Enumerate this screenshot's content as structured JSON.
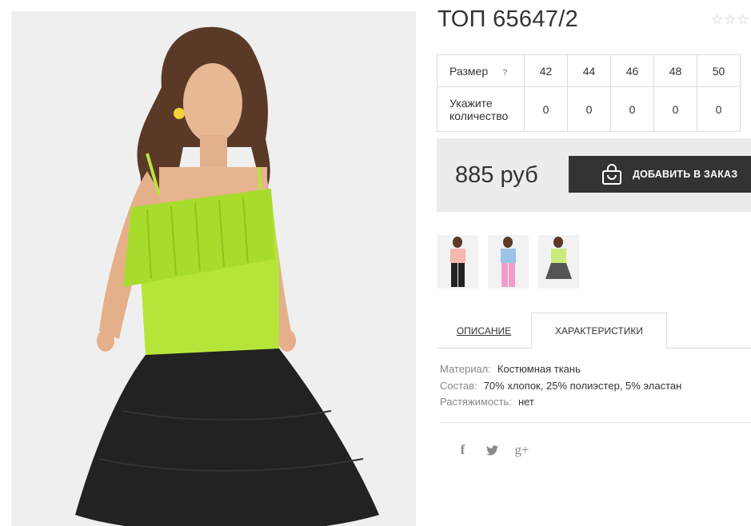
{
  "product": {
    "title": "ТОП 65647/2",
    "rating_stars": [
      "☆",
      "☆",
      "☆"
    ]
  },
  "size_table": {
    "size_label": "Размер",
    "help": "?",
    "sizes": [
      "42",
      "44",
      "46",
      "48",
      "50"
    ],
    "qty_label_line1": "Укажите",
    "qty_label_line2": "количество",
    "quantities": [
      "0",
      "0",
      "0",
      "0",
      "0"
    ]
  },
  "order": {
    "price": "885 руб",
    "add_button_label": "ДОБАВИТЬ В ЗАКАЗ"
  },
  "tabs": {
    "description": "ОПИСАНИЕ",
    "characteristics": "ХАРАКТЕРИСТИКИ"
  },
  "characteristics": [
    {
      "key": "Материал:",
      "value": "Костюмная ткань"
    },
    {
      "key": "Состав:",
      "value": "70% хлопок, 25% полиэстер, 5% эластан"
    },
    {
      "key": "Растяжимость:",
      "value": "нет"
    }
  ],
  "social": {
    "facebook": "f",
    "twitter": "t",
    "gplus": "g+"
  },
  "colors": {
    "top_lime": "#b6e53a",
    "skirt_black": "#222222",
    "button_dark": "#333333",
    "panel_grey": "#ececec"
  },
  "icons": [
    "shopping-bag-icon",
    "facebook-icon",
    "twitter-icon",
    "google-plus-icon",
    "star-icon",
    "help-icon"
  ]
}
